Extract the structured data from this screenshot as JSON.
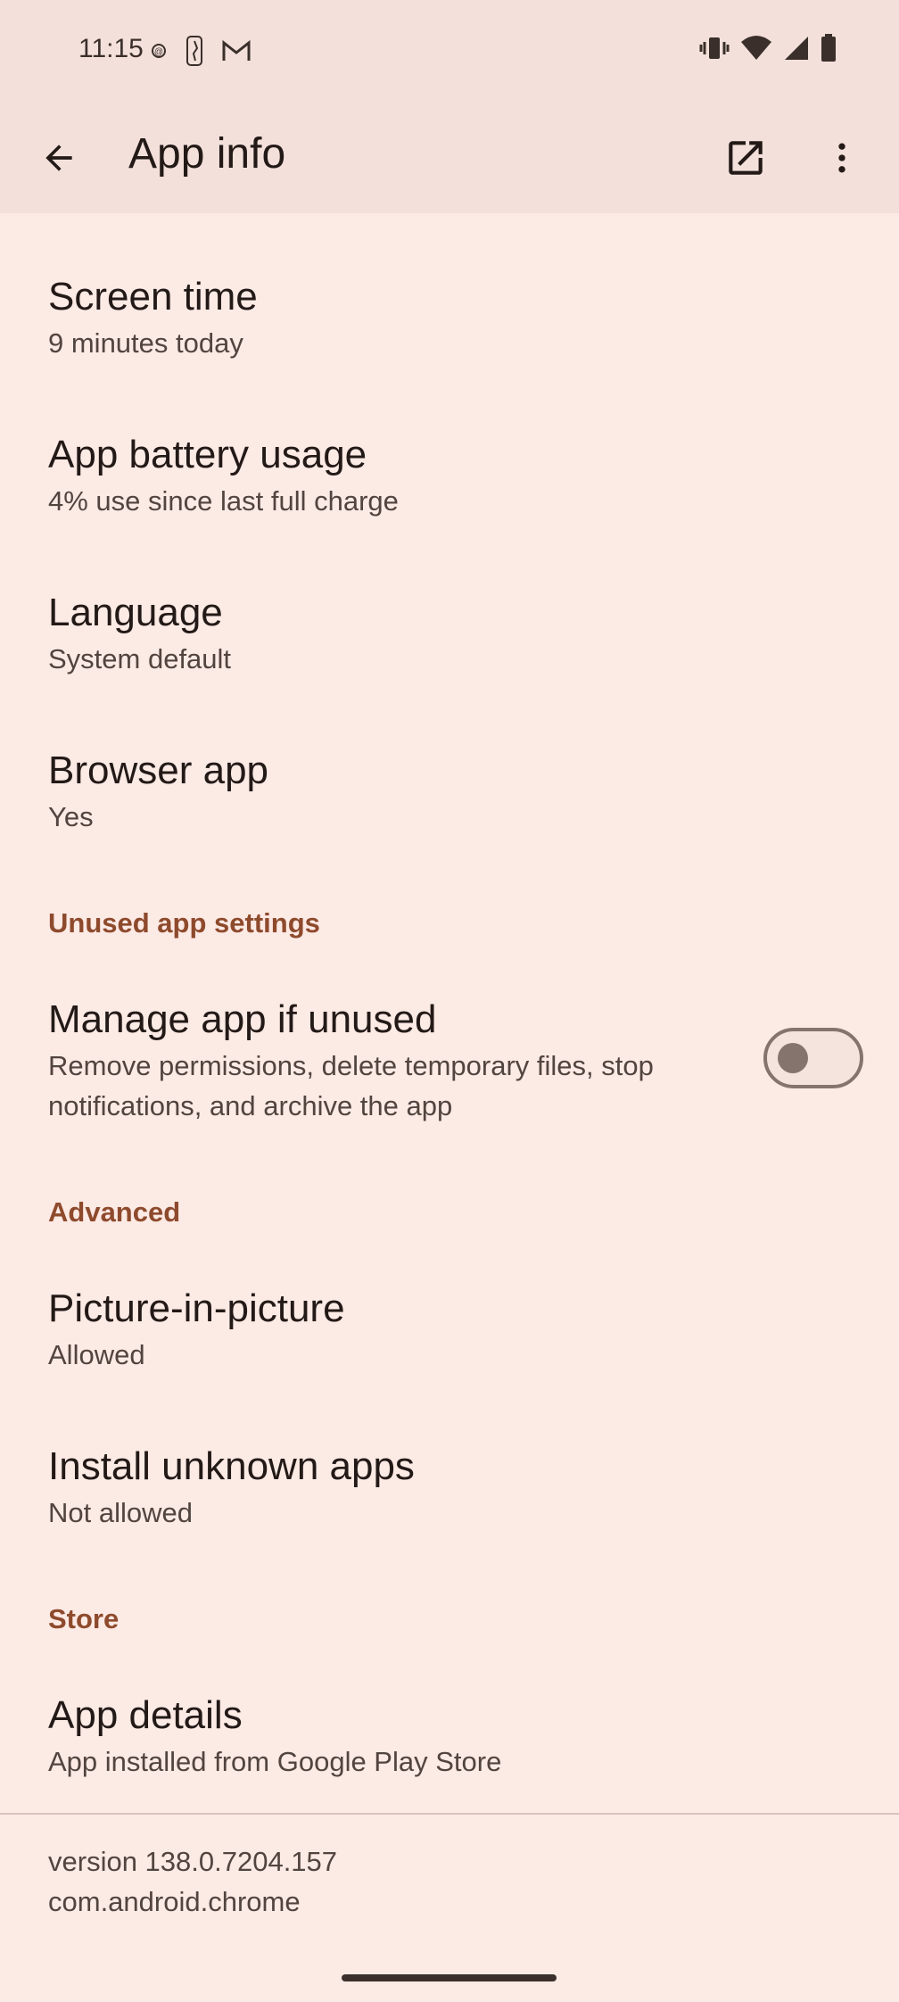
{
  "status_bar": {
    "time": "11:15",
    "left_icons": [
      "data-saver-icon",
      "nba-icon",
      "gmail-icon"
    ],
    "right_icons": [
      "vibrate-icon",
      "wifi-icon",
      "signal-icon",
      "battery-icon"
    ]
  },
  "app_bar": {
    "title": "App info",
    "back_icon": "arrow-back-icon",
    "open_icon": "open-in-new-icon",
    "more_icon": "more-vert-icon"
  },
  "items": [
    {
      "title": "Screen time",
      "summary": "9 minutes today"
    },
    {
      "title": "App battery usage",
      "summary": "4% use since last full charge"
    },
    {
      "title": "Language",
      "summary": "System default"
    },
    {
      "title": "Browser app",
      "summary": "Yes"
    }
  ],
  "sections": {
    "unused": {
      "header": "Unused app settings",
      "manage": {
        "title": "Manage app if unused",
        "summary_line1": "Remove permissions, delete temporary files, stop",
        "summary_line2": "notifications, and archive the app",
        "toggle_on": false
      }
    },
    "advanced": {
      "header": "Advanced",
      "items": [
        {
          "title": "Picture-in-picture",
          "summary": "Allowed"
        },
        {
          "title": "Install unknown apps",
          "summary": "Not allowed"
        }
      ]
    },
    "store": {
      "header": "Store",
      "items": [
        {
          "title": "App details",
          "summary": "App installed from Google Play Store"
        }
      ]
    }
  },
  "footer": {
    "version": "version 138.0.7204.157",
    "package": "com.android.chrome"
  },
  "colors": {
    "background": "#fceae5",
    "app_bar": "#f3e0da",
    "accent": "#8e4a2c"
  }
}
